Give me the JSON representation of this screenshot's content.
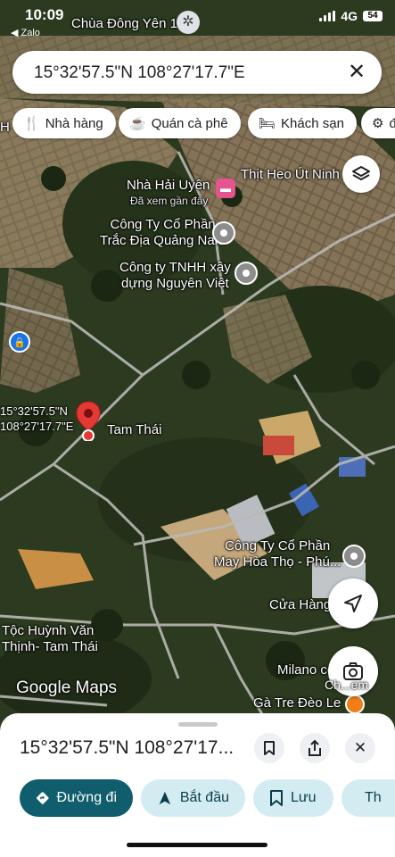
{
  "status": {
    "time": "10:09",
    "back": "◀ Zalo",
    "network": "4G",
    "battery": "54"
  },
  "search": {
    "query": "15°32'57.5\"N 108°27'17.7\"E",
    "clear_icon": "close-icon"
  },
  "chips": [
    {
      "label": "Nhà hàng",
      "icon": "restaurant-icon"
    },
    {
      "label": "Quán cà phê",
      "icon": "coffee-icon"
    },
    {
      "label": "Khách sạn",
      "icon": "hotel-icon"
    },
    {
      "label": "đ",
      "icon": "gear-icon"
    }
  ],
  "map": {
    "top_label": "Chùa Đông Yên 1",
    "labels": {
      "thit_heo": "Thịt Heo Út Ninh",
      "nha_hai_uyen": "Nhà Hải Uyên",
      "nha_hai_uyen_sub": "Đã xem gần đây",
      "trac_dia": "Công Ty Cổ Phần\nTrắc Địa Quảng Nam",
      "nguyen_viet": "Công ty TNHH xây\ndựng Nguyên Việt",
      "pin_coords": "15°32'57.5\"N\n108°27'17.7\"E",
      "tam_thai": "Tam Thái",
      "may_hoa_tho": "Công Ty Cổ Phần\nMay Hòa Thọ - Phú...",
      "cua_hang": "Cửa Hàng",
      "toc_huynh": "Tộc Huỳnh Văn\nThịnh- Tam Thái",
      "milano": "Milano coffe",
      "ga_tre": "Gà Tre Đèo Le",
      "left_edge": "H"
    },
    "watermark": "Google Maps",
    "lens_label": "Ch...em"
  },
  "sheet": {
    "coords": "15°32'57.5\"N 108°27'17...",
    "actions": [
      {
        "label": "Đường đi",
        "icon": "directions-icon"
      },
      {
        "label": "Bắt đầu",
        "icon": "navigation-icon"
      },
      {
        "label": "Lưu",
        "icon": "bookmark-icon"
      },
      {
        "label": "Th",
        "icon": "flag-icon"
      }
    ]
  },
  "colors": {
    "primary_action": "#0f5d6d",
    "secondary_action": "#d3ecf2",
    "pin_red": "#e53935"
  }
}
